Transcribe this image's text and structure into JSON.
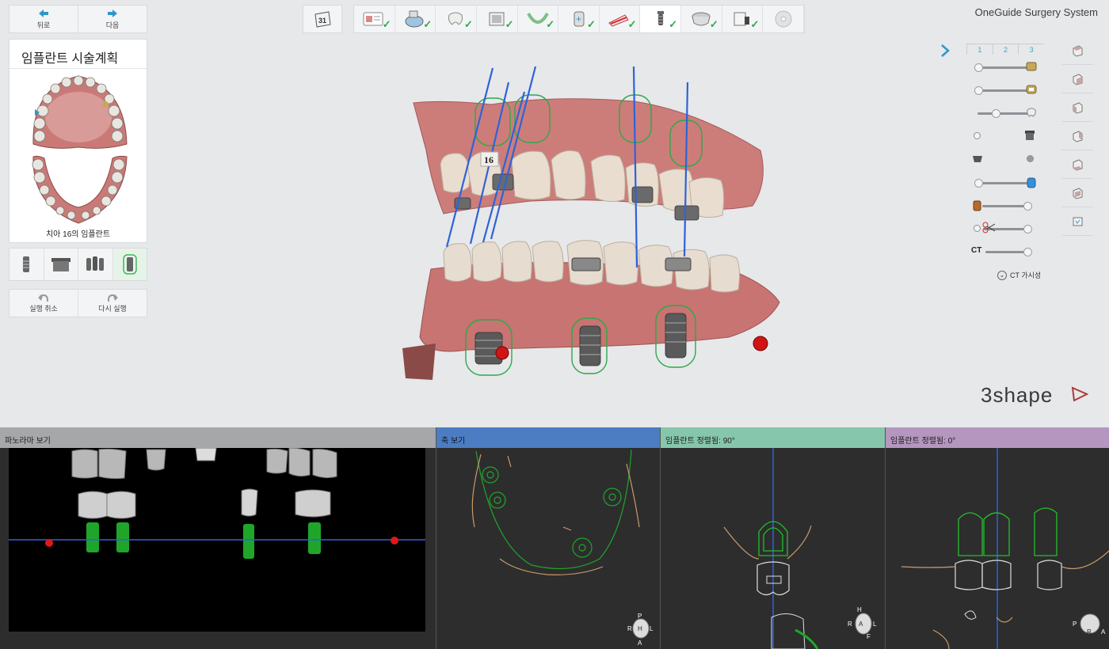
{
  "nav": {
    "back_label": "뒤로",
    "next_label": "다음"
  },
  "calendar": {
    "label": "31"
  },
  "app": {
    "title": "OneGuide Surgery System"
  },
  "left_panel": {
    "title": "임플란트 시술계획",
    "caption": "치아 16의 임플란트"
  },
  "history": {
    "undo_label": "실행 취소",
    "redo_label": "다시 실행"
  },
  "visibility": {
    "levels": [
      "1",
      "2",
      "3"
    ],
    "ct_label": "CT",
    "ct_visibility_label": "CT 가시성"
  },
  "viewport": {
    "tooth_label": "16"
  },
  "brand": {
    "logo_text": "3shape"
  },
  "panels": {
    "panorama": "파노라마 보기",
    "axial": "축 보기",
    "implant_90": "임플란트 정렬됨: 90°",
    "implant_0": "임플란트 정렬됨: 0°"
  },
  "orientation": {
    "axial": {
      "top": "P",
      "left": "R",
      "center": "H",
      "right": "L",
      "bottom": "A"
    },
    "implant_90": {
      "top": "H",
      "left": "R",
      "center": "A",
      "right": "L",
      "bottom": "F"
    },
    "implant_0": {
      "left": "P",
      "center": "R",
      "right": "A"
    }
  },
  "colors": {
    "accent_blue": "#3aa6b9",
    "check_green": "#2fa84a",
    "implant_green": "#22c02b",
    "marker_red": "#e01818",
    "gum_pink": "#d98a85"
  }
}
